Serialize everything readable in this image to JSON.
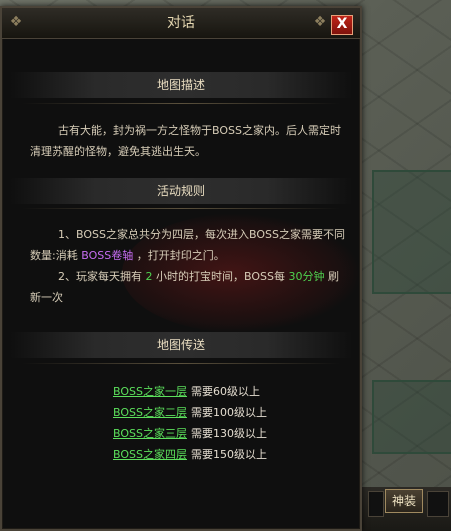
{
  "dialog": {
    "title": "对话",
    "close_label": "X",
    "sections": {
      "map_desc": {
        "header": "地图描述",
        "text": "古有大能，封为祸一方之怪物于BOSS之家内。后人需定时清理苏醒的怪物，避免其逃出生天。"
      },
      "rules": {
        "header": "活动规则",
        "line1_a": "1、BOSS之家总共分为四层，每次进入BOSS之家需要不同数量:消耗",
        "line1_item": "BOSS卷轴",
        "line1_b": "，打开封印之门。",
        "line2_a": "2、玩家每天拥有",
        "line2_hours": "2",
        "line2_b": "小时的打宝时间，BOSS每",
        "line2_minutes": "30分钟",
        "line2_c": "刷新一次"
      },
      "teleport": {
        "header": "地图传送",
        "floors": [
          {
            "name": "BOSS之家一层",
            "req": "需要60级以上"
          },
          {
            "name": "BOSS之家二层",
            "req": "需要100级以上"
          },
          {
            "name": "BOSS之家三层",
            "req": "需要130级以上"
          },
          {
            "name": "BOSS之家四层",
            "req": "需要150级以上"
          }
        ]
      }
    }
  },
  "hud": {
    "divine_button": "神装"
  },
  "colors": {
    "link_green": "#5ce05c",
    "item_purple": "#c66df2",
    "close_red": "#c02418"
  }
}
